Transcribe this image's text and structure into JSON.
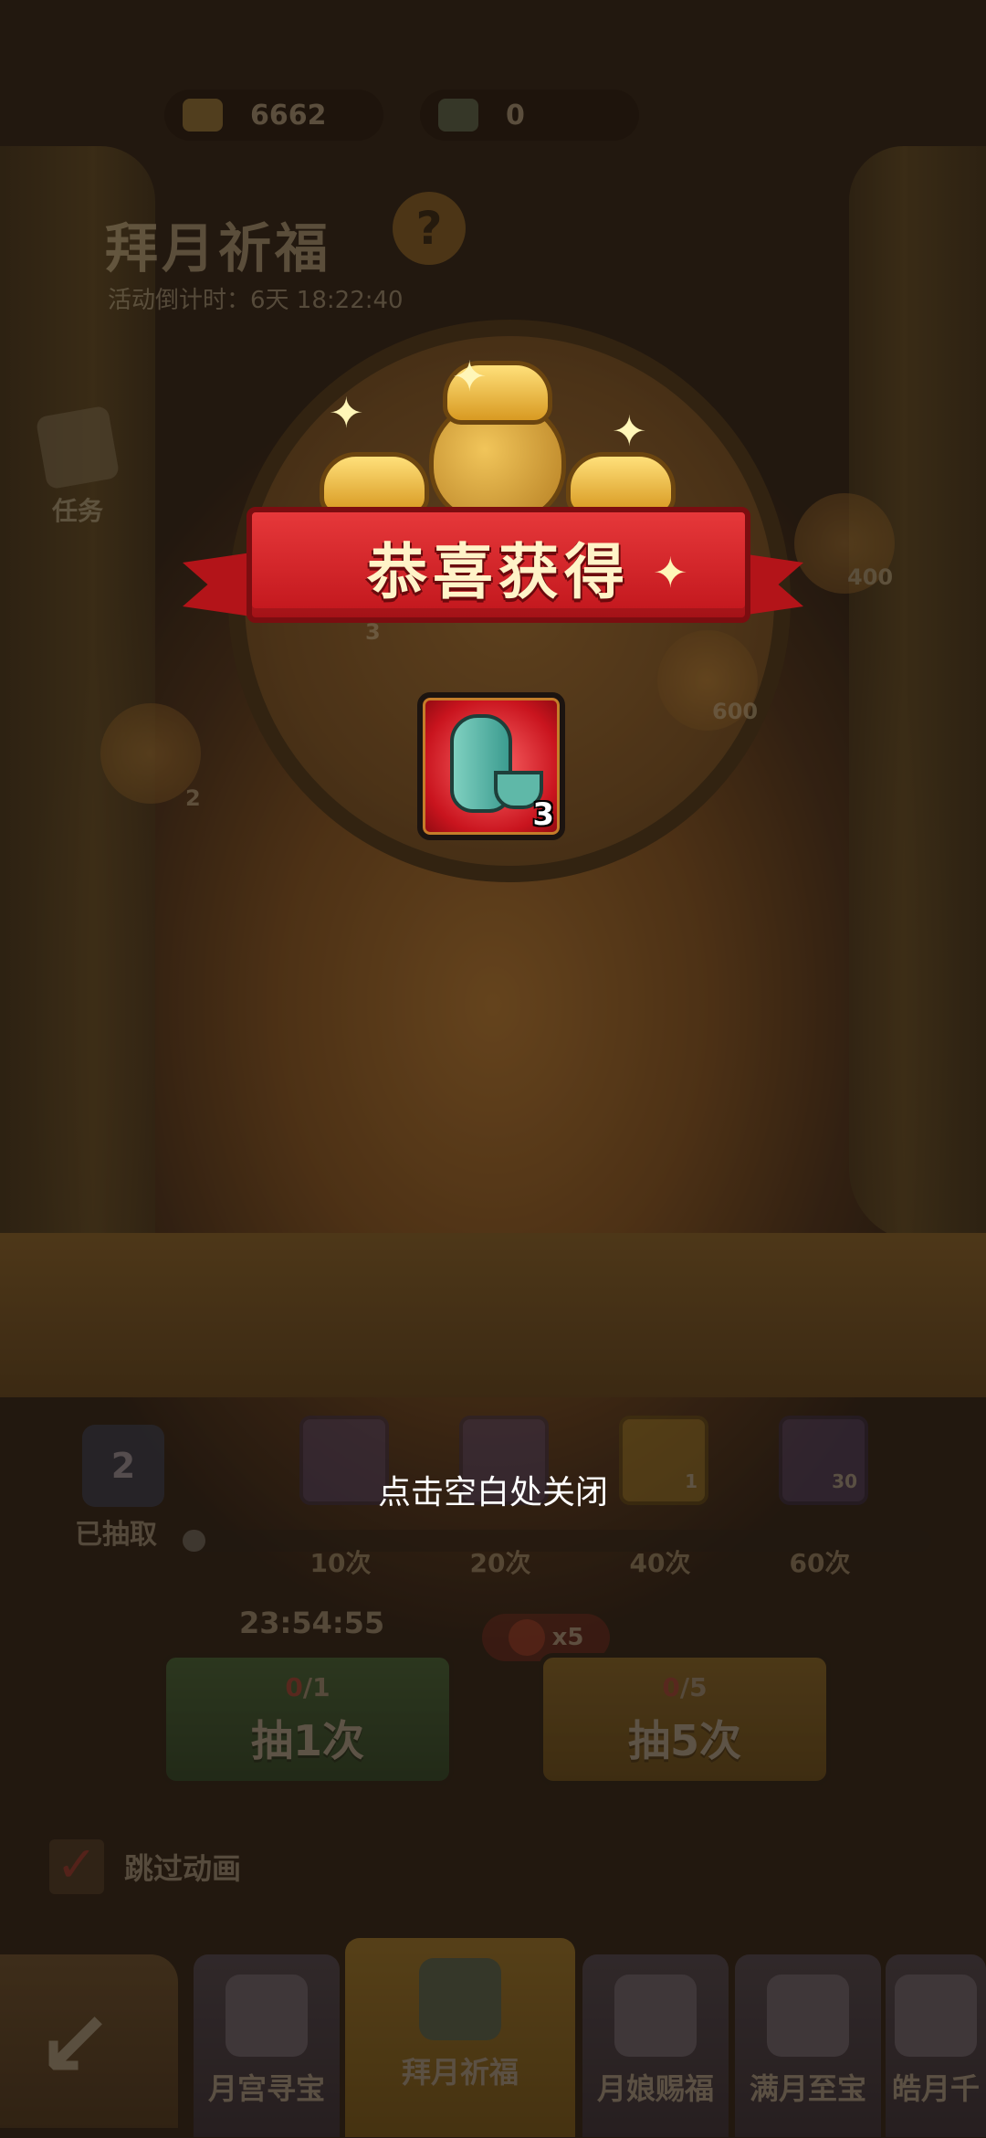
{
  "header": {
    "gold_amount": "6662",
    "fan_amount": "0",
    "title": "拜月祈福",
    "help_symbol": "?",
    "countdown": "活动倒计时：6天 18:22:40",
    "task_label": "任务"
  },
  "background_nodes": {
    "left_count": "2",
    "mid_count": "3",
    "right_top_count": "400",
    "right_mid_count": "600"
  },
  "popup": {
    "banner_title": "恭喜获得",
    "reward_item_icon": "vase-and-cup-icon",
    "reward_count": "3",
    "close_hint": "点击空白处关闭"
  },
  "progress": {
    "drawn_count": "2",
    "drawn_label": "已抽取",
    "fill_fraction": 0.03,
    "milestones": [
      {
        "label": "10次",
        "count": ""
      },
      {
        "label": "20次",
        "count": ""
      },
      {
        "label": "40次",
        "count": "1"
      },
      {
        "label": "60次",
        "count": "30"
      }
    ]
  },
  "draw": {
    "timer": "23:54:55",
    "refresh_multiplier": "x5",
    "draw1": {
      "cost_used": "0",
      "cost_total": "/1",
      "label": "抽1次"
    },
    "draw5": {
      "cost_used": "0",
      "cost_total": "/5",
      "label": "抽5次"
    },
    "skip_label": "跳过动画",
    "skip_checked": true
  },
  "nav": {
    "back_icon": "back-arrow-icon",
    "tabs": [
      {
        "label": "月宫寻宝"
      },
      {
        "label": "拜月祈福"
      },
      {
        "label": "月娘赐福"
      },
      {
        "label": "满月至宝"
      },
      {
        "label": "皓月千"
      }
    ]
  },
  "colors": {
    "banner_red": "#d4242a",
    "draw1_green": "#3f7a3f",
    "draw5_gold": "#a67f22"
  }
}
